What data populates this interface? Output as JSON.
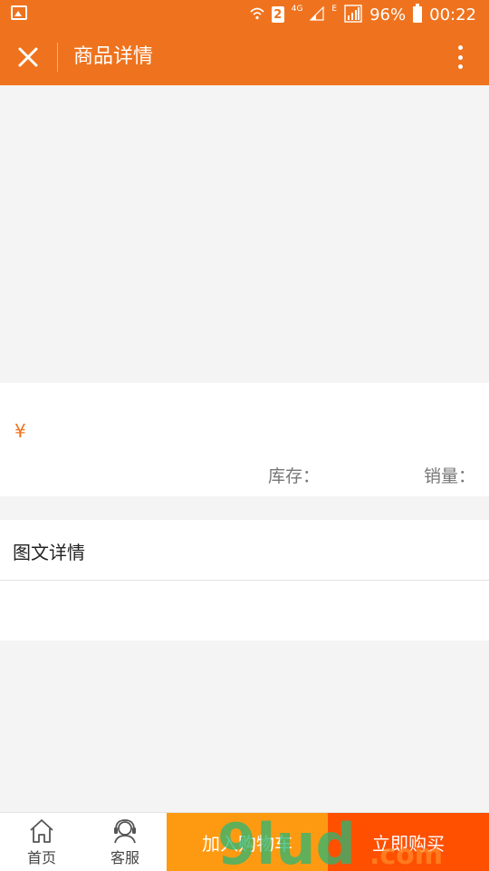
{
  "status_bar": {
    "sim_badge": "2",
    "network_type": "4G",
    "edge_badge": "E",
    "battery_percent": "96%",
    "time": "00:22"
  },
  "header": {
    "title": "商品详情",
    "close_icon": "close-icon",
    "more_icon": "more-vertical-icon"
  },
  "product": {
    "currency_symbol": "¥",
    "stock_label": "库存：",
    "sales_label": "销量："
  },
  "detail": {
    "title": "图文详情"
  },
  "bottom_nav": {
    "home_label": "首页",
    "service_label": "客服",
    "add_to_cart_label": "加入购物车",
    "buy_now_label": "立即购买"
  },
  "watermark": {
    "main": "9lud",
    "suffix": ".com"
  },
  "colors": {
    "brand": "#ef731e",
    "cart_button": "#fe9a12",
    "buy_button": "#ff5000",
    "background": "#f4f4f4"
  }
}
